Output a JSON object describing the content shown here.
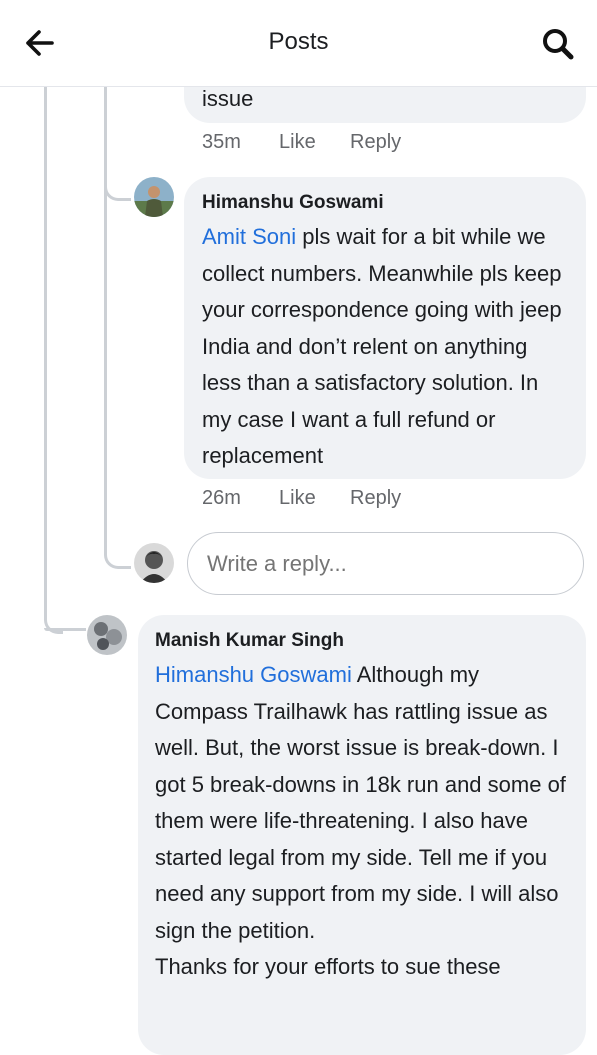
{
  "header": {
    "title": "Posts",
    "back_icon": "arrow-left-icon",
    "search_icon": "search-icon"
  },
  "comments": [
    {
      "author": "",
      "text_tail": "issue",
      "time": "35m",
      "like": "Like",
      "reply": "Reply"
    },
    {
      "author": "Himanshu Goswami",
      "mention": "Amit Soni",
      "text": " pls wait for a bit while we collect numbers. Meanwhile pls keep your correspondence going with jeep India and don’t relent on anything less than a satisfactory solution. In my case I want a full refund or replacement",
      "time": "26m",
      "like": "Like",
      "reply": "Reply"
    },
    {
      "author": "Manish Kumar Singh",
      "mention": "Himanshu Goswami",
      "text": " Although my Compass Trailhawk has rattling issue as well. But, the worst issue is break-down. I got 5 break-downs in 18k run and some of them were life-threatening. I also have started legal from my side. Tell me if you need any support from my side. I will also sign the petition.",
      "text2": "Thanks for your efforts to sue these"
    }
  ],
  "reply_box": {
    "placeholder": "Write a reply..."
  },
  "colors": {
    "link": "#216fdb",
    "bubble": "#f0f2f5",
    "meta": "#65676b",
    "thread_line": "#ccd0d5"
  }
}
